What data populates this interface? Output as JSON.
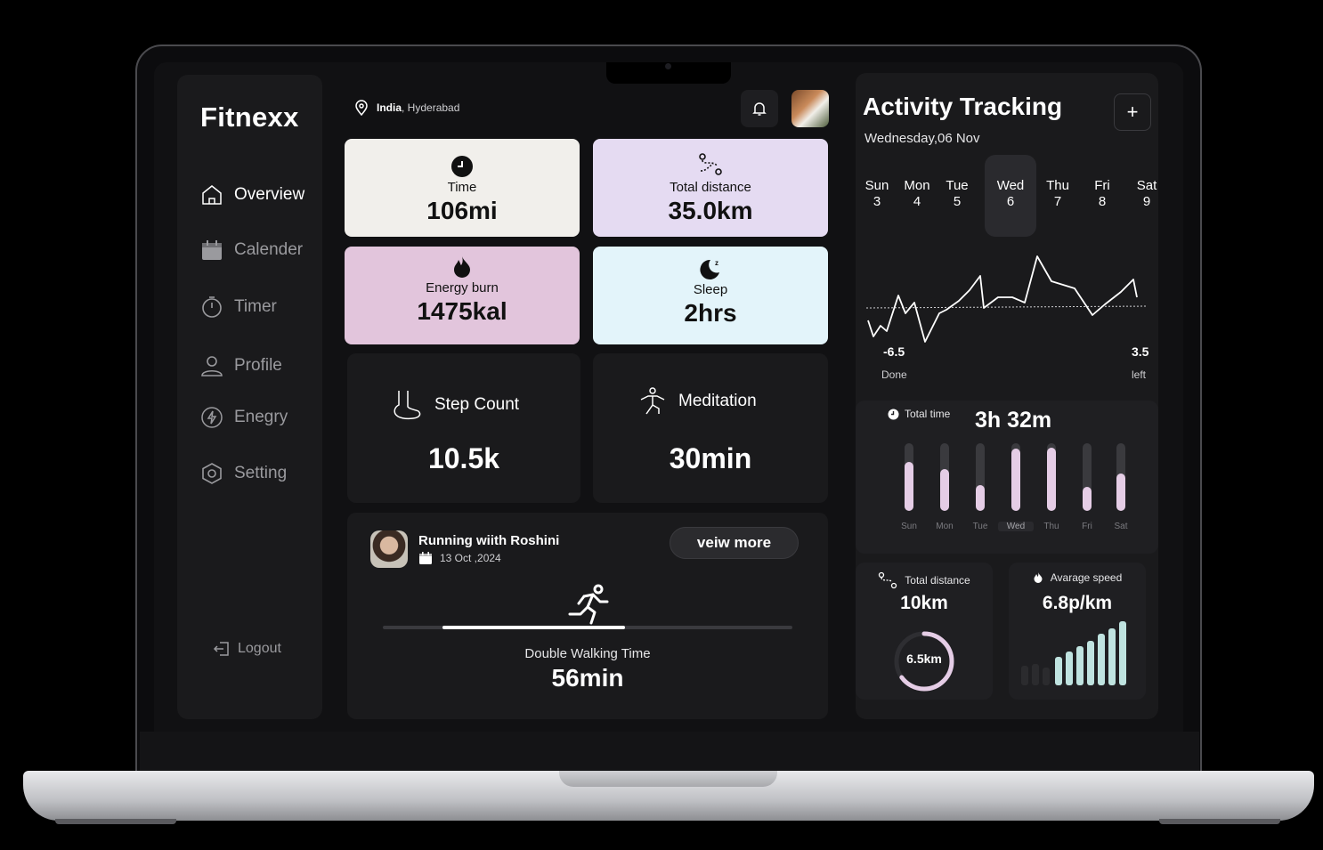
{
  "brand": "Fitnexx",
  "nav": {
    "overview": "Overview",
    "calender": "Calender",
    "timer": "Timer",
    "profile": "Profile",
    "energy": "Enegry",
    "setting": "Setting",
    "logout": "Logout"
  },
  "location": {
    "country": "India",
    "city": ", Hyderabad"
  },
  "stats": {
    "time": {
      "label": "Time",
      "value": "106mi",
      "bg": "#f1efeb"
    },
    "distance": {
      "label": "Total distance",
      "value": "35.0km",
      "bg": "#e5dbf2"
    },
    "energy": {
      "label": "Energy burn",
      "value": "1475kal",
      "bg": "#e2c5dc"
    },
    "sleep": {
      "label": "Sleep",
      "value": "2hrs",
      "bg": "#e3f4fa"
    }
  },
  "step_count": {
    "label": "Step Count",
    "value": "10.5k"
  },
  "meditation": {
    "label": "Meditation",
    "value": "30min"
  },
  "run": {
    "title": "Running wiith Roshini",
    "date": "13 Oct ,2024",
    "button": "veiw more",
    "walk_label": "Double Walking Time",
    "walk_value": "56min",
    "progress": 0.67
  },
  "activity": {
    "title": "Activity Tracking",
    "date": "Wednesday,06 Nov",
    "add": "+",
    "days": [
      {
        "name": "Sun",
        "num": "3"
      },
      {
        "name": "Mon",
        "num": "4"
      },
      {
        "name": "Tue",
        "num": "5"
      },
      {
        "name": "Wed",
        "num": "6"
      },
      {
        "name": "Thu",
        "num": "7"
      },
      {
        "name": "Fri",
        "num": "8"
      },
      {
        "name": "Sat",
        "num": "9"
      }
    ],
    "done_value": "-6.5",
    "done_label": "Done",
    "left_value": "3.5",
    "left_label": "left"
  },
  "total_time": {
    "label": "Total time",
    "value": "3h 32m",
    "days": [
      "Sun",
      "Mon",
      "Tue",
      "Wed",
      "Thu",
      "Fri",
      "Sat"
    ],
    "levels": [
      0.73,
      0.62,
      0.38,
      0.92,
      0.94,
      0.35,
      0.55
    ],
    "accent": "#e5cde6"
  },
  "total_distance": {
    "label": "Total distance",
    "value": "10km",
    "ring_value": "6.5km",
    "ring_level": 0.65
  },
  "avg_speed": {
    "label": "Avarage speed",
    "value": "6.8p/km",
    "accent": "#bfe3e0"
  }
}
